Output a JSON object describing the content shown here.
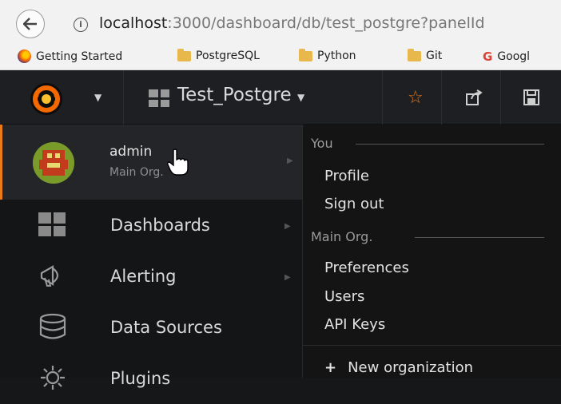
{
  "browser": {
    "url_host": "localhost",
    "url_path": ":3000/dashboard/db/test_postgre?panelId",
    "bookmarks": [
      {
        "label": "Getting Started",
        "icon": "firefox-icon"
      },
      {
        "label": "PostgreSQL",
        "icon": "folder-icon"
      },
      {
        "label": "Python",
        "icon": "folder-icon"
      },
      {
        "label": "Git",
        "icon": "folder-icon"
      },
      {
        "label": "Googl",
        "icon": "google-icon"
      }
    ]
  },
  "navbar": {
    "dashboard_title": "Test_Postgre",
    "accent_color": "#eb7b18"
  },
  "profile": {
    "name": "admin",
    "org": "Main Org."
  },
  "sidemenu": {
    "items": [
      {
        "label": "Dashboards",
        "icon": "dashboards-icon",
        "has_submenu": true
      },
      {
        "label": "Alerting",
        "icon": "bell-icon",
        "has_submenu": true
      },
      {
        "label": "Data Sources",
        "icon": "database-icon",
        "has_submenu": false
      },
      {
        "label": "Plugins",
        "icon": "plugins-icon",
        "has_submenu": false
      }
    ]
  },
  "dropdown": {
    "section_you": "You",
    "profile": "Profile",
    "sign_out": "Sign out",
    "section_org": "Main Org.",
    "preferences": "Preferences",
    "users": "Users",
    "api_keys": "API Keys",
    "new_org_icon": "+",
    "new_org": "New organization"
  }
}
